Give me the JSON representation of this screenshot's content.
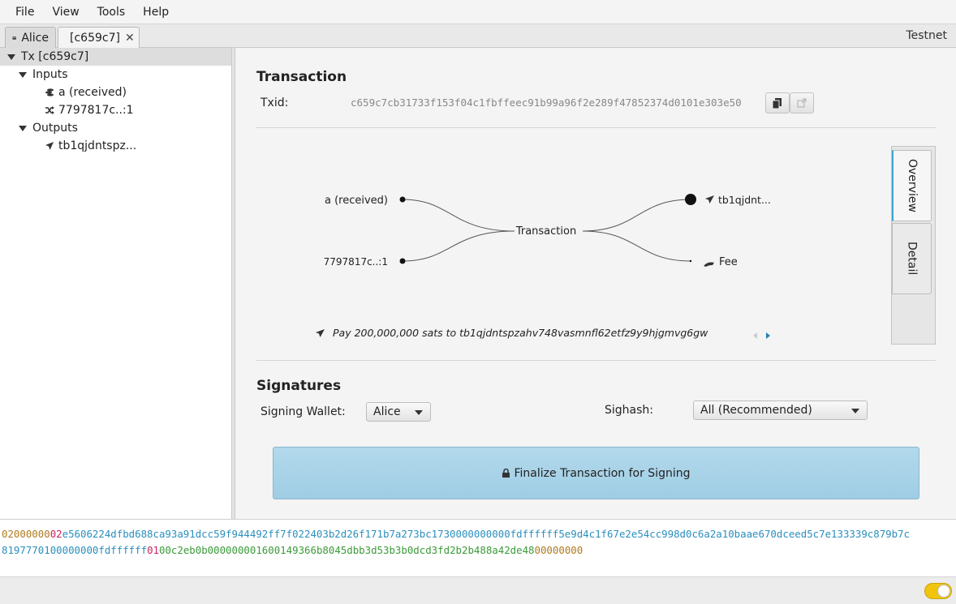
{
  "menu": [
    "File",
    "View",
    "Tools",
    "Help"
  ],
  "tabs": [
    {
      "label": "Alice",
      "icon": "wallet-icon"
    },
    {
      "label": "[c659c7]",
      "icon": "send-icon",
      "close": "✕"
    }
  ],
  "network": "Testnet",
  "tree": {
    "root": "Tx [c659c7]",
    "inputs_label": "Inputs",
    "inputs": [
      "a (received)",
      "7797817c..:1"
    ],
    "outputs_label": "Outputs",
    "outputs": [
      "tb1qjdntspz..."
    ]
  },
  "transaction": {
    "title": "Transaction",
    "txid_label": "Txid:",
    "txid": "c659c7cb31733f153f04c1fbffeec91b99a96f2e289f47852374d0101e303e50"
  },
  "diagram": {
    "inputs": [
      "a (received)",
      "7797817c..:1"
    ],
    "center": "Transaction",
    "outputs": [
      "tb1qjdnt...",
      "Fee"
    ],
    "payment_text": "Pay 200,000,000 sats to tb1qjdntspzahv748vasmnfl62etfz9y9hjgmvg6gw"
  },
  "side_tabs": [
    "Overview",
    "Detail"
  ],
  "signatures": {
    "title": "Signatures",
    "wallet_label": "Signing Wallet:",
    "wallet_value": "Alice",
    "sighash_label": "Sighash:",
    "sighash_value": "All (Recommended)",
    "finalize_label": "Finalize Transaction for Signing"
  },
  "hex": {
    "line1": [
      {
        "text": "02000000",
        "color": "#b07a1f"
      },
      {
        "text": "02",
        "color": "#d02060"
      },
      {
        "text": "e5606224dfbd688ca93a91dcc59f944492ff7f022403b2d26f171b7a273bc173",
        "color": "#2a8fbd"
      },
      {
        "text": "00000000",
        "color": "#2a8fbd"
      },
      {
        "text": "00",
        "color": "#2a8fbd"
      },
      {
        "text": "fdffffff",
        "color": "#2a8fbd"
      },
      {
        "text": "5e9d4c1f67e2e54cc998d0c6a2a10baae670dceed5c7e133339c879b7c",
        "color": "#2a8fbd"
      }
    ],
    "line2": [
      {
        "text": "81977701",
        "color": "#2a8fbd"
      },
      {
        "text": "00000000",
        "color": "#2a8fbd"
      },
      {
        "text": "fdffffff",
        "color": "#2a8fbd"
      },
      {
        "text": "01",
        "color": "#d02060"
      },
      {
        "text": "00c2eb0b00000000",
        "color": "#3a9a3a"
      },
      {
        "text": "160014",
        "color": "#3a9a3a"
      },
      {
        "text": "9366b8045dbb3d53b3b0dcd3fd2b2b488a42de48",
        "color": "#3a9a3a"
      },
      {
        "text": "00000000",
        "color": "#b07a1f"
      }
    ]
  },
  "colors": {
    "accent": "#3ea5d6",
    "finalize_bg": "#a7d3e8",
    "toggle": "#f1c40f"
  }
}
